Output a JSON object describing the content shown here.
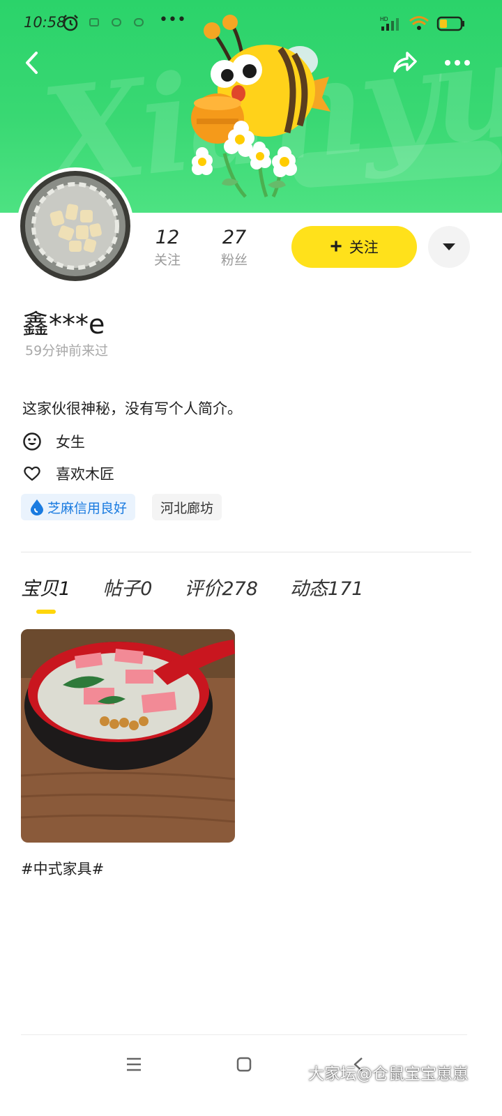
{
  "status_bar": {
    "time": "10:58"
  },
  "banner": {
    "watermark": "Xianyu"
  },
  "profile": {
    "following_count": "12",
    "following_label": "关注",
    "followers_count": "27",
    "followers_label": "粉丝",
    "follow_button": "关注",
    "username": "鑫***e",
    "last_seen": "59分钟前来过",
    "bio": "这家伙很神秘，没有写个人简介。",
    "gender": "女生",
    "likes": "喜欢木匠",
    "credit_tag": "芝麻信用良好",
    "location_tag": "河北廊坊"
  },
  "tabs": [
    {
      "label": "宝贝",
      "count": "1"
    },
    {
      "label": "帖子",
      "count": "0"
    },
    {
      "label": "评价",
      "count": "278"
    },
    {
      "label": "动态",
      "count": "171"
    }
  ],
  "items": [
    {
      "caption": "#中式家具#"
    }
  ],
  "watermark": "大家坛@仓鼠宝宝崽崽",
  "colors": {
    "banner": "#2bd36a",
    "follow_button": "#ffe11b",
    "tab_indicator": "#ffd60a",
    "credit_blue": "#1a7be0"
  }
}
